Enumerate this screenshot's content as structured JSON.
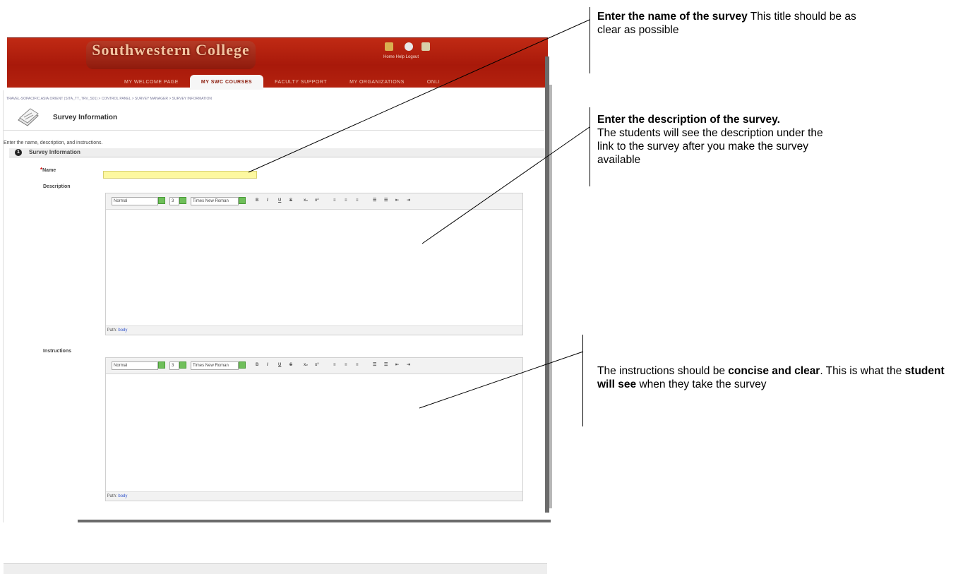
{
  "header": {
    "logo_line1": "Southwestern College",
    "logo_line2": "",
    "icons": [
      "home-icon",
      "help-icon",
      "logout-icon"
    ],
    "icon_labels": "Home  Help  Logout"
  },
  "tabs": [
    {
      "label": "MY WELCOME PAGE",
      "active": false
    },
    {
      "label": "MY SWC COURSES",
      "active": true
    },
    {
      "label": "FACULTY SUPPORT",
      "active": false
    },
    {
      "label": "MY ORGANIZATIONS",
      "active": false
    },
    {
      "label": "ONLI",
      "active": false
    }
  ],
  "breadcrumb": "TRAVEL-SOPACIFIC.ASIA.ORIENT (SITA_TT_TRV_S01) > CONTROL PANEL > SURVEY MANAGER > SURVEY INFORMATION",
  "page": {
    "title": "Survey Information",
    "intro": "Enter the name, description, and instructions."
  },
  "section": {
    "number": "1",
    "title": "Survey Information"
  },
  "fields": {
    "required_mark": "*",
    "name_label": "Name",
    "name_value": "",
    "description_label": "Description",
    "instructions_label": "Instructions"
  },
  "editor_toolbar": {
    "style": "Normal",
    "size": "3",
    "font": "Times New Roman",
    "buttons": [
      "B",
      "I",
      "U",
      "S",
      "x₂",
      "x²",
      "≡",
      "≡",
      "≡",
      "☰",
      "☰",
      "⇤",
      "⇥"
    ]
  },
  "editor_path": {
    "label": "Path:",
    "value": "body"
  },
  "callouts": {
    "name_bold": "Enter the name of the survey",
    "name_rest": " This title should be as clear as possible",
    "description_bold": "Enter the description of the survey.",
    "description_rest": "The students will see the description under the link to the survey after you make the survey available",
    "instructions_part1": "The instructions should be ",
    "instructions_bold1": "concise and clear",
    "instructions_part2": ". This is what the ",
    "instructions_bold2": "student will see",
    "instructions_part3": " when they take the survey"
  },
  "colors": {
    "header_red": "#b4220f",
    "name_field_yellow": "#fdf8a0",
    "link_blue": "#3355cc"
  }
}
